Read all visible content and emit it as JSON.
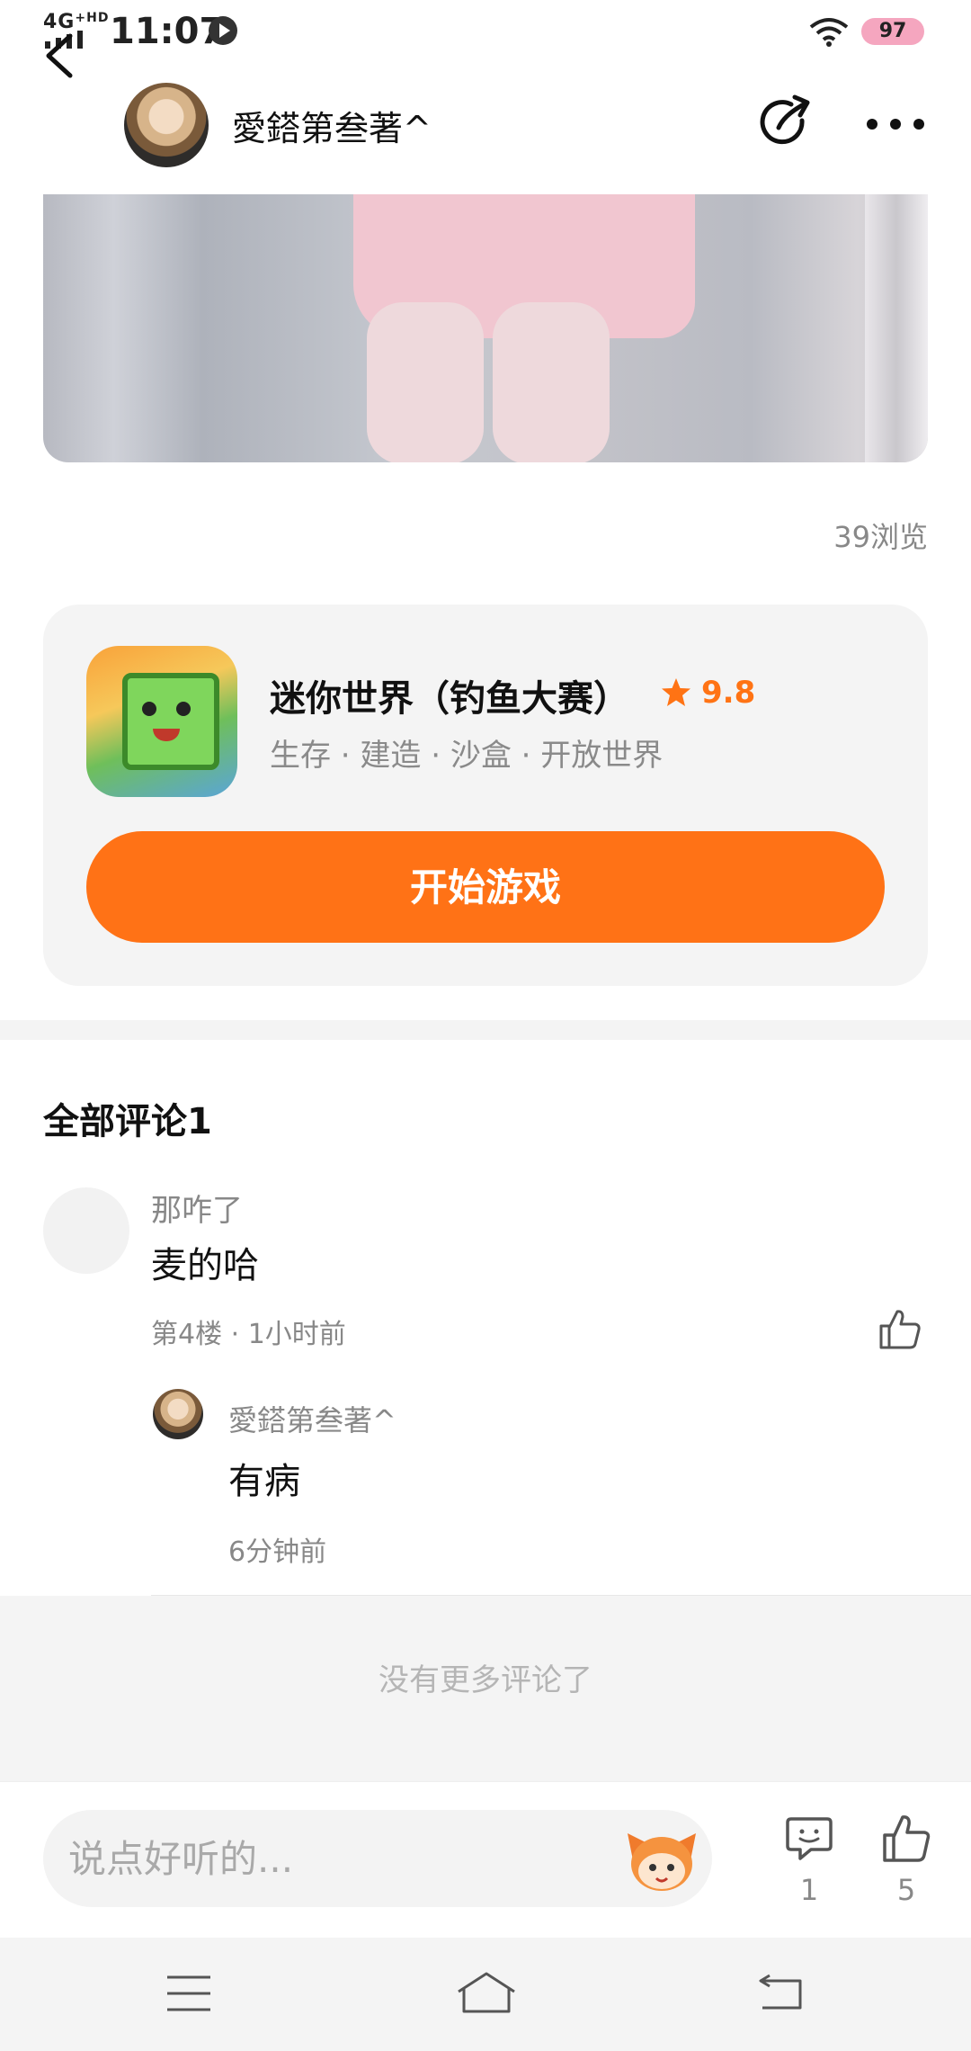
{
  "status_bar": {
    "network": "4G",
    "network_sup": "+HD",
    "time": "11:07",
    "battery": "97"
  },
  "header": {
    "username": "愛鎝第叁著^"
  },
  "post": {
    "views": "39浏览"
  },
  "game": {
    "title": "迷你世界（钓鱼大赛）",
    "rating": "9.8",
    "tags": "生存 · 建造 · 沙盒 · 开放世界",
    "play_label": "开始游戏"
  },
  "comments": {
    "title": "全部评论1",
    "items": [
      {
        "author": "那咋了",
        "text": "麦的哈",
        "meta": "第4楼 · 1小时前",
        "replies": [
          {
            "author": "愛鎝第叁著^",
            "text": "有病",
            "time": "6分钟前"
          }
        ]
      }
    ],
    "end_text": "没有更多评论了"
  },
  "bottom_bar": {
    "input_placeholder": "说点好听的...",
    "comment_count": "1",
    "like_count": "5"
  },
  "colors": {
    "accent": "#ff7216",
    "rating": "#ff7314",
    "battery": "#f5a6bf"
  },
  "icons": [
    "back-icon",
    "share-icon",
    "more-icon",
    "star-icon",
    "thumbs-up-icon",
    "comment-icon",
    "mascot-icon",
    "menu-icon",
    "home-icon",
    "nav-back-icon"
  ]
}
